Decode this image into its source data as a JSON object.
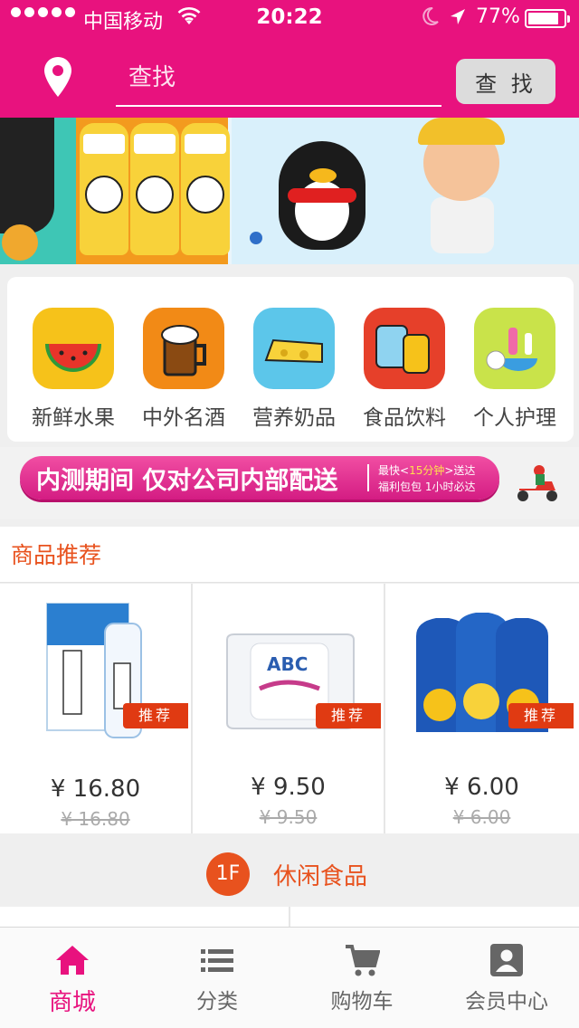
{
  "status_bar": {
    "carrier": "中国移动",
    "time": "20:22",
    "battery": "77%"
  },
  "header": {
    "search_placeholder": "查找",
    "search_button": "查 找"
  },
  "categories": [
    {
      "label": "新鲜水果",
      "icon": "watermelon-icon",
      "color": "#f6c21a"
    },
    {
      "label": "中外名酒",
      "icon": "beer-icon",
      "color": "#f28a16"
    },
    {
      "label": "营养奶品",
      "icon": "cheese-icon",
      "color": "#5cc6ea"
    },
    {
      "label": "食品饮料",
      "icon": "snacks-icon",
      "color": "#e6402a"
    },
    {
      "label": "个人护理",
      "icon": "toiletries-icon",
      "color": "#c9e34a"
    }
  ],
  "promo": {
    "main": "内测期间  仅对公司内部配送",
    "line1_pre": "最快<",
    "line1_hl": "15分钟",
    "line1_post": ">送达",
    "line2": "福利包包  1小时必达"
  },
  "recommend": {
    "title": "商品推荐",
    "badge": "推荐",
    "products": [
      {
        "price": "¥ 16.80",
        "old_price": "¥ 16.80",
        "image": "toothpaste-image"
      },
      {
        "price": "¥ 9.50",
        "old_price": "¥ 9.50",
        "image": "sanitary-pads-image"
      },
      {
        "price": "¥ 6.00",
        "old_price": "¥ 6.00",
        "image": "capri-sun-image"
      }
    ]
  },
  "floor": {
    "badge": "1F",
    "title": "休闲食品"
  },
  "tabs": [
    {
      "label": "商城",
      "icon": "home-icon",
      "active": true
    },
    {
      "label": "分类",
      "icon": "list-icon",
      "active": false
    },
    {
      "label": "购物车",
      "icon": "cart-icon",
      "active": false
    },
    {
      "label": "会员中心",
      "icon": "member-icon",
      "active": false
    }
  ],
  "colors": {
    "brand": "#e8127e",
    "accent": "#e8521e"
  }
}
